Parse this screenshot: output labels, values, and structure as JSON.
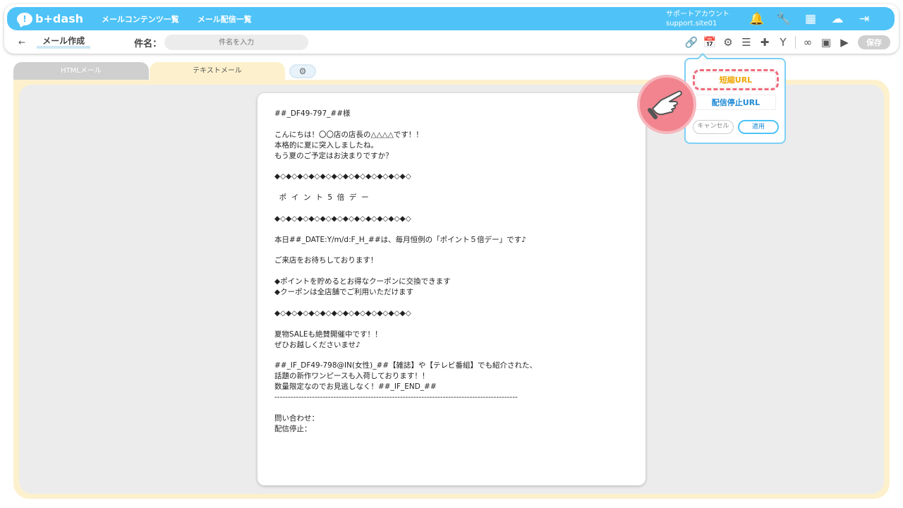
{
  "app": {
    "logo_text": "b+dash",
    "logo_badge": "!",
    "nav": [
      "メールコンテンツ一覧",
      "メール配信一覧"
    ],
    "account_label": "サポートアカウント",
    "account_site": "support.site01"
  },
  "top_icons": [
    "bell-icon",
    "wrench-icon",
    "grid-icon",
    "user-switch-icon",
    "logout-icon"
  ],
  "subbar": {
    "back_arrow": "←",
    "page_title": "メール作成",
    "subject_label": "件名：",
    "subject_placeholder": "件名を入力",
    "subject_value": "",
    "save_label": "保存",
    "tools": [
      "link-icon",
      "calendar-icon",
      "gears-icon",
      "database-icon",
      "add-doc-icon",
      "branch-icon",
      "chain-icon",
      "contact-icon",
      "play-icon"
    ]
  },
  "tabs": {
    "html": "HTMLメール",
    "text": "テキストメール",
    "settings": "gear-icon"
  },
  "email_body": [
    "##_DF49-797_##様",
    "",
    "こんにちは！〇〇店の店長の△△△△です！！",
    "本格的に夏に突入しましたね。",
    "もう夏のご予定はお決まりですか？",
    "",
    "◆◇◆◇◆◇◆◇◆◇◆◇◆◇◆◇◆◇◆◇◆◇◆◇",
    "",
    "  ポ  イ  ン  ト  5  倍  デ  ー",
    "",
    "◆◇◆◇◆◇◆◇◆◇◆◇◆◇◆◇◆◇◆◇◆◇◆◇",
    "",
    "本日##_DATE:Y/m/d:F_H_##は、毎月恒例の「ポイント５倍デー」です♪",
    "",
    "ご来店をお待ちしております！",
    "",
    "◆ポイントを貯めるとお得なクーポンに交換できます",
    "◆クーポンは全店舗でご利用いただけます",
    "",
    "◆◇◆◇◆◇◆◇◆◇◆◇◆◇◆◇◆◇◆◇◆◇◆◇",
    "",
    "夏物SALEも絶賛開催中です！！",
    "ぜひお越しくださいませ♪",
    "",
    "##_IF_DF49-798@IN(女性)_##【雑誌】や【テレビ番組】でも紹介された、",
    "話題の新作ワンピースも入荷しております！！",
    "数量限定なのでお見逃しなく！##_IF_END_##",
    "-------------------------------------------------------------------------------------------",
    "",
    "問い合わせ：",
    "配信停止："
  ],
  "popup": {
    "short_url": "短縮URL",
    "unsubscribe_url": "配信停止URL",
    "cancel": "キャンセル",
    "apply": "適用"
  },
  "colors": {
    "brand": "#4fc3f7",
    "tab_active": "#fdf1cd",
    "highlight": "#ef6b7a",
    "short_url_text": "#f0a500"
  }
}
